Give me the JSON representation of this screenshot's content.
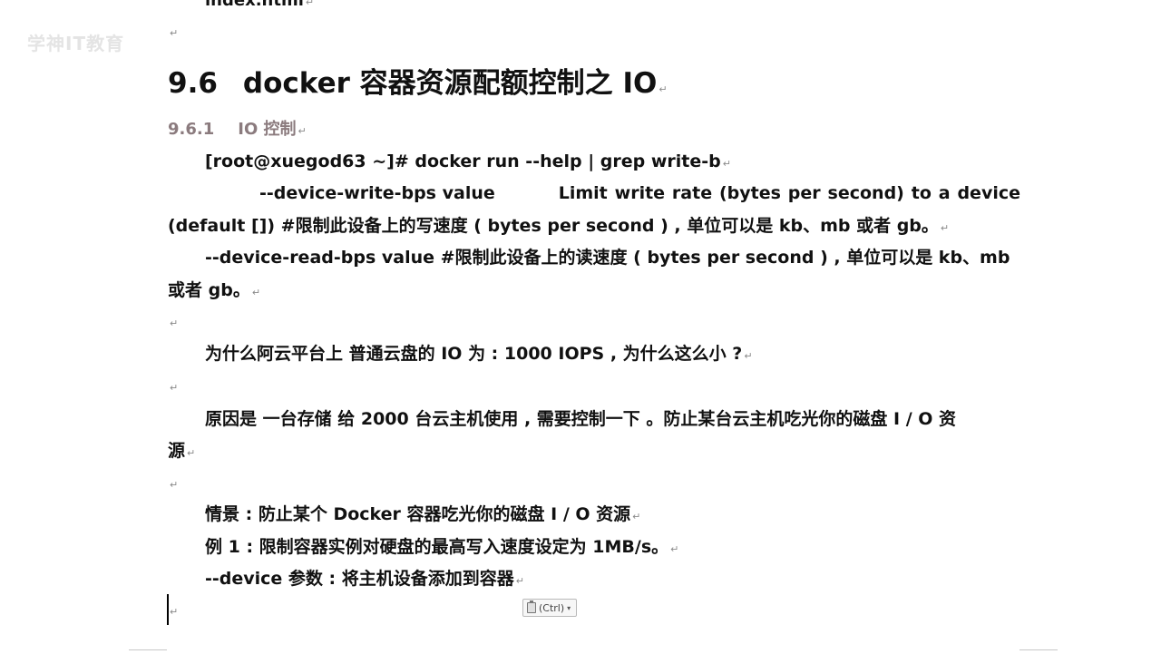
{
  "top_fragment": "index.html",
  "watermark": "学神IT教育",
  "heading": {
    "number": "9.6",
    "title": "docker 容器资源配额控制之 IO"
  },
  "subheading": {
    "number": "9.6.1",
    "title": "IO 控制"
  },
  "command": "[root@xuegod63 ~]# docker run --help | grep write-b",
  "option_write": {
    "name": "--device-write-bps value",
    "desc_words": [
      "Limit",
      "write",
      "rate",
      "(bytes",
      "per",
      "second)",
      "to",
      "a",
      "device"
    ],
    "line2": "(default [])   #限制此设备上的写速度 ( bytes  per second ) , 单位可以是 kb、mb 或者 gb。"
  },
  "option_read": {
    "line1": "--device-read-bps value      #限制此设备上的读速度 ( bytes per second ) , 单位可以是 kb、mb",
    "line2": "或者 gb。"
  },
  "question": "为什么阿云平台上  普通云盘的 IO 为 :   1000  IOPS   , 为什么这么小 ?",
  "reason": {
    "line1": "原因是  一台存储  给 2000 台云主机使用 , 需要控制一下  。防止某台云主机吃光你的磁盘  I  /  O  资",
    "line2": "源"
  },
  "scenario": "情景 : 防止某个   Docker  容器吃光你的磁盘   I / O  资源",
  "example": "例 1 : 限制容器实例对硬盘的最高写入速度设定为    1MB/s。",
  "device_param": "--device 参数 : 将主机设备添加到容器",
  "paragraph_mark": "↵",
  "paste_options_label": "(Ctrl)",
  "colors": {
    "subheading": "#8b7b7e",
    "text": "#111111",
    "paragraph_mark": "#8a8a8a"
  }
}
